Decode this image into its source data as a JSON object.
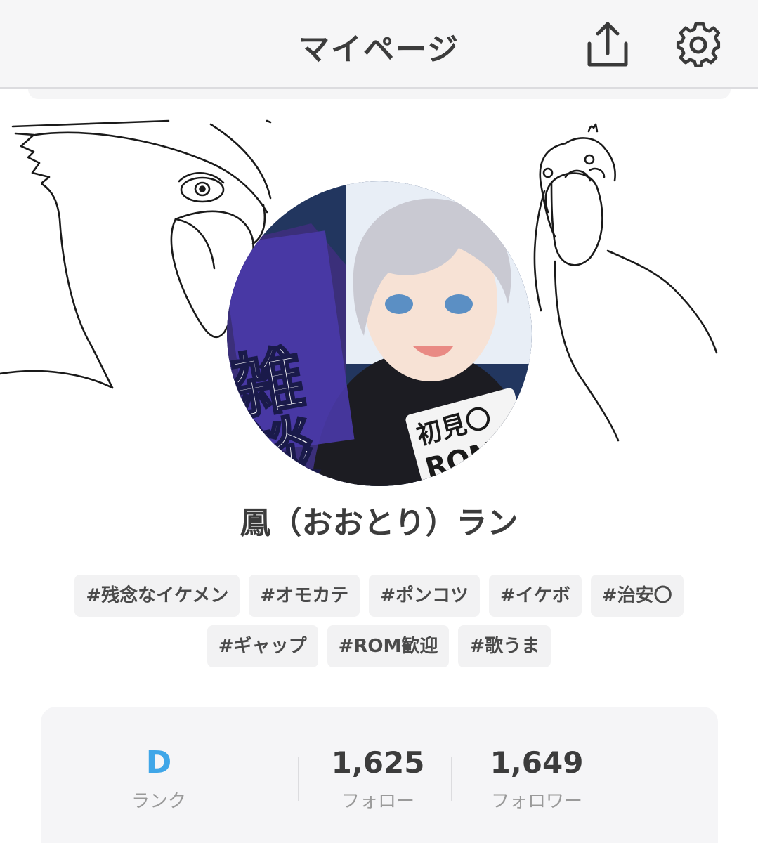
{
  "header": {
    "title": "マイページ",
    "share_icon": "share-upload-icon",
    "settings_icon": "gear-icon"
  },
  "profile": {
    "name": "鳳（おおとり）ラン",
    "avatar_overlay_text": [
      "雑談",
      "初見〇",
      "ROM"
    ]
  },
  "tags_row1": [
    "#残念なイケメン",
    "#オモカテ",
    "#ポンコツ",
    "#イケボ",
    "#治安〇"
  ],
  "tags_row2": [
    "#ギャップ",
    "#ROM歓迎",
    "#歌うま"
  ],
  "stats": {
    "rank": {
      "value": "D",
      "label": "ランク"
    },
    "follow": {
      "value": "1,625",
      "label": "フォロー"
    },
    "follower": {
      "value": "1,649",
      "label": "フォロワー"
    }
  },
  "colors": {
    "header_bg": "#f6f6f7",
    "rank_accent": "#3fa6e8",
    "tag_bg": "#f2f2f3",
    "stats_bg": "#f5f5f7"
  }
}
